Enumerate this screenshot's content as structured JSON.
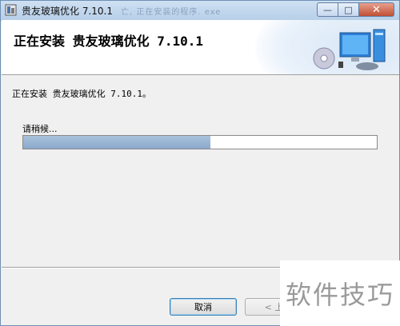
{
  "window": {
    "title": "贵友玻璃优化 7.10.1",
    "ghost_title": "亡, 正在安装的程序. exe",
    "minimize_icon": "minimize-icon",
    "maximize_icon": "maximize-icon",
    "close_icon": "close-icon"
  },
  "banner": {
    "title": "正在安装 贵友玻璃优化 7.10.1"
  },
  "content": {
    "status": "正在安装 贵友玻璃优化 7.10.1。",
    "wait_label": "请稍候...",
    "progress_percent": 53
  },
  "buttons": {
    "cancel": "取消",
    "back": "< 上一"
  },
  "watermark": "软件技巧"
}
